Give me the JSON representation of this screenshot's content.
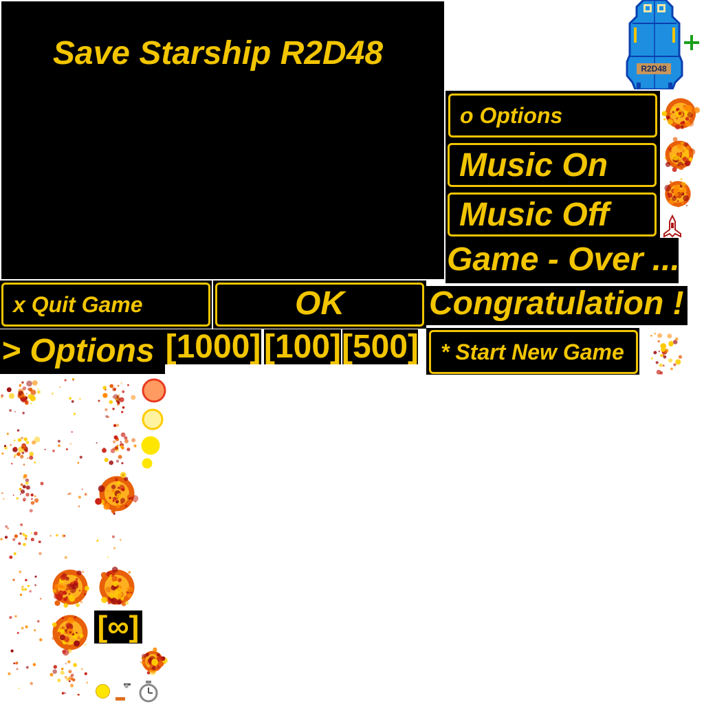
{
  "title_panel": {
    "title": "Save Starship R2D48"
  },
  "ship": {
    "label": "R2D48"
  },
  "buttons": {
    "options_small": "o Options",
    "music_on": "Music On",
    "music_off": "Music Off",
    "quit_game": "x Quit Game",
    "ok": "OK",
    "start_new_game": "* Start New Game"
  },
  "labels": {
    "game_over": "Game - Over ...",
    "congratulation": "Congratulation !",
    "options_header": "> Options"
  },
  "scores": [
    "[1000]",
    "[100]",
    "[500]"
  ],
  "infinity": "[∞]",
  "colors": {
    "accent": "#f2c500",
    "panel": "#000000",
    "ship": "#1e8fe0",
    "plus": "#1aa01a"
  },
  "icons": [
    "plus-icon",
    "rocket-icon",
    "stopwatch-icon",
    "explosion-icon"
  ]
}
